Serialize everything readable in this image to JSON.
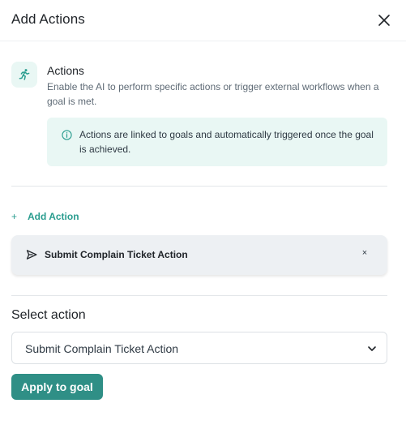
{
  "dialog": {
    "title": "Add Actions",
    "close_icon": "close-icon"
  },
  "actions_section": {
    "icon": "running-person-icon",
    "title": "Actions",
    "description": "Enable the AI to perform specific actions or trigger external workflows when a goal is met.",
    "info": {
      "icon": "info-icon",
      "text": "Actions are linked to goals and automatically triggered once the goal is achieved."
    }
  },
  "add_action": {
    "icon": "plus-icon",
    "plus_glyph": "+",
    "label": "Add Action"
  },
  "added_actions": [
    {
      "icon": "send-icon",
      "label": "Submit Complain Ticket Action",
      "remove_glyph": "×"
    }
  ],
  "select_action": {
    "label": "Select action",
    "selected_value": "Submit Complain Ticket Action",
    "chevron_icon": "chevron-down-icon"
  },
  "apply_button": {
    "label": "Apply to goal"
  },
  "colors": {
    "accent": "#2a9d8f",
    "button": "#2f8f86",
    "info_bg": "#e9f7f4",
    "card_bg": "#edf0f3"
  }
}
